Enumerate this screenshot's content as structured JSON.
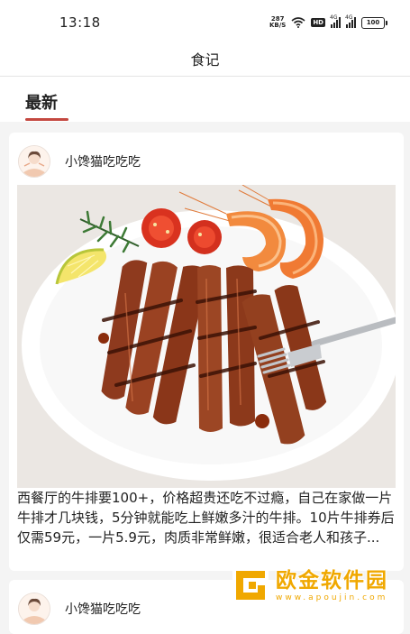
{
  "status_bar": {
    "time": "13:18",
    "net_speed_value": "287",
    "net_speed_unit": "KB/S",
    "hd_label": "HD",
    "signal1_label": "4G",
    "signal2_label": "4G",
    "battery_level": "100"
  },
  "header": {
    "title": "食记"
  },
  "tabs": [
    {
      "label": "最新",
      "active": true
    }
  ],
  "posts": [
    {
      "author": "小馋猫吃吃吃",
      "image_icon": "steak-plate-photo",
      "text": "西餐厅的牛排要100+，价格超贵还吃不过瘾，自己在家做一片牛排才几块钱，5分钟就能吃上鲜嫩多汁的牛排。10片牛排券后仅需59元，一片5.9元，肉质非常鲜嫩，很适合老人和孩子..."
    },
    {
      "author": "小馋猫吃吃吃"
    }
  ],
  "watermark": {
    "title": "欧金软件园",
    "url": "www.apoujin.com"
  },
  "colors": {
    "accent": "#c44840",
    "watermark": "#f0a800",
    "background": "#f4f4f4"
  }
}
